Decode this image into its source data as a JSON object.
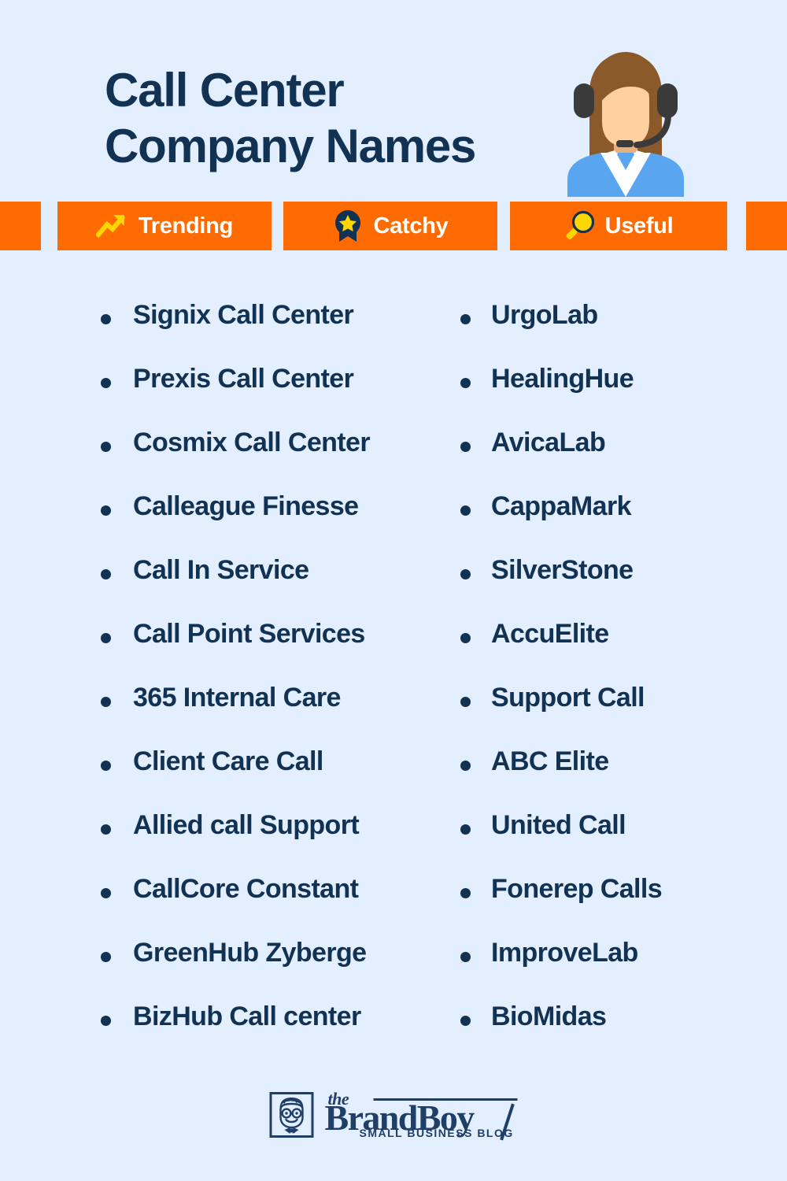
{
  "colors": {
    "background": "#e3efff",
    "navy": "#123253",
    "orange": "#ff6b00",
    "badge_text": "#ffffff",
    "icon_yellow": "#ffd700",
    "logo_navy": "#1f3f66",
    "agent_hair": "#8a5a2b",
    "agent_skin": "#ffd1a0",
    "agent_jacket": "#5aa5f0",
    "agent_headset": "#3a3a3a",
    "agent_shirt": "#ffffff"
  },
  "header": {
    "title_line_1": "Call Center",
    "title_line_2": "Company Names",
    "illustration_name": "call-center-agent-with-headset"
  },
  "badges": [
    {
      "label": "Trending",
      "icon": "trending-up-arrow-icon"
    },
    {
      "label": "Catchy",
      "icon": "award-ribbon-star-icon"
    },
    {
      "label": "Useful",
      "icon": "magnifying-glass-icon"
    }
  ],
  "lists": {
    "left_column": [
      "Signix Call Center",
      "Prexis Call Center",
      "Cosmix Call Center",
      "Calleague Finesse",
      "Call In Service",
      "Call Point Services",
      "365 Internal Care",
      "Client Care Call",
      "Allied call Support",
      "CallCore Constant",
      "GreenHub Zyberge",
      "BizHub Call center"
    ],
    "right_column": [
      "UrgoLab",
      "HealingHue",
      "AvicaLab",
      "CappaMark",
      "SilverStone",
      "AccuElite",
      "Support Call",
      "ABC Elite",
      "United Call",
      "Fonerep Calls",
      "ImproveLab",
      "BioMidas"
    ]
  },
  "footer": {
    "logo_the": "the",
    "logo_main": "BrandBoy",
    "logo_sub": "SMALL BUSINESS BLOG",
    "logo_mark_name": "brandboy-face-icon"
  }
}
